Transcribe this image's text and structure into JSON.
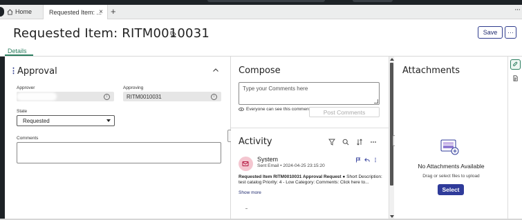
{
  "tabs": {
    "home_label": "Home",
    "active_label": "Requested Item: ...",
    "close_glyph": "×",
    "add_glyph": "+",
    "more_glyph": "···"
  },
  "header": {
    "title": "Requested Item: RITM0010031",
    "save_label": "Save",
    "more_glyph": "···",
    "details_tab": "Details"
  },
  "approval": {
    "title": "Approval",
    "approver_label": "Approver",
    "approver_value": "",
    "approving_label": "Approving",
    "approving_value": "RITM0010031",
    "state_label": "State",
    "state_value": "Requested",
    "comments_label": "Comments",
    "comments_value": "",
    "info_glyph": "i"
  },
  "compose": {
    "title": "Compose",
    "placeholder": "Type your Comments here",
    "visibility_note": "Everyone can see this comment",
    "post_label": "Post Comments"
  },
  "activity": {
    "title": "Activity",
    "entry": {
      "author": "System",
      "type": "Sent Email",
      "timestamp": "2024-04-25 23:15:20",
      "bold_text": "Requested Item RITM0010031 Approval Request",
      "body_text": " ● Short Description: test catalog Priority: 4 - Low Category: Comments: Click here to...",
      "show_more": "Show more"
    }
  },
  "attachments": {
    "title": "Attachments",
    "empty_title": "No Attachments Available",
    "hint": "Drag or select files to upload",
    "select_label": "Select"
  },
  "colors": {
    "accent": "#2a7d5e",
    "primary": "#2f3b9a",
    "avatar_bg": "#f4c6d0",
    "avatar_fg": "#b3163f"
  }
}
